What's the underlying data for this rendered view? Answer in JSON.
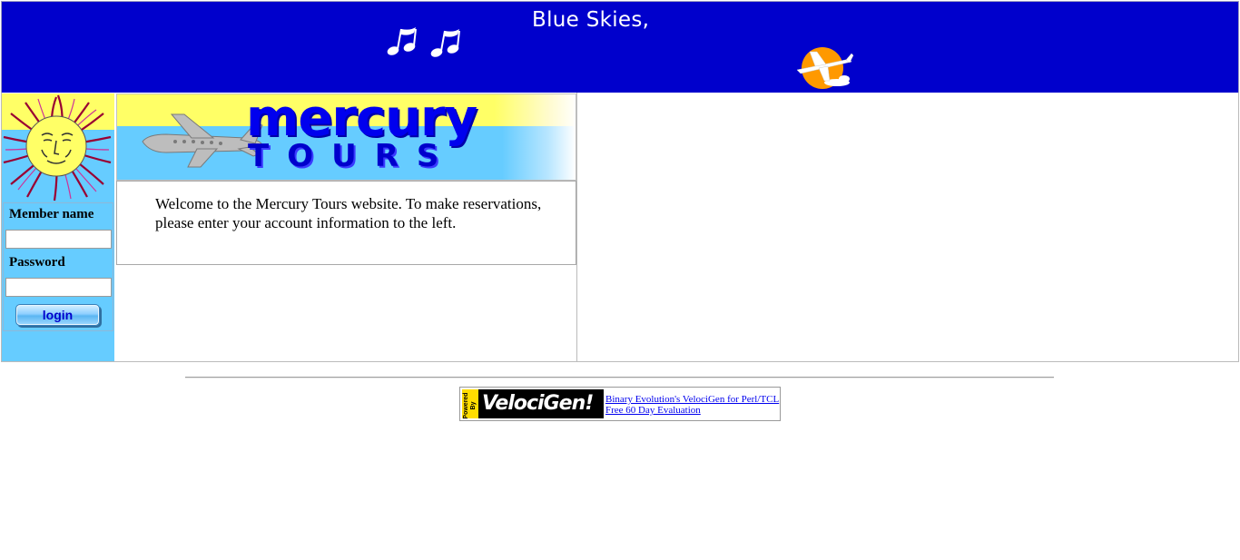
{
  "banner": {
    "title": "Blue Skies,"
  },
  "logo": {
    "brand_top": "mercury",
    "brand_bottom": "TOURS"
  },
  "login": {
    "member_label": "Member name",
    "member_value": "",
    "password_label": "Password",
    "password_value": "",
    "button_label": "login"
  },
  "welcome": {
    "text": "Welcome to the Mercury Tours website. To make reservations, please enter your account information to the left."
  },
  "footer": {
    "badge_powered": "Powered By",
    "badge_name": "VelociGen!",
    "link_line1": "Binary Evolution's VelociGen for Perl/TCL",
    "link_line2": "Free 60 Day Evaluation"
  },
  "colors": {
    "banner_bg": "#0000cc",
    "panel_bg": "#66ccff",
    "logo_yellow": "#ffff66",
    "brand_blue": "#0000ee"
  },
  "icons": [
    "music-notes-icon",
    "sun-airplane-icon",
    "sun-face-logo",
    "airplane-icon"
  ]
}
